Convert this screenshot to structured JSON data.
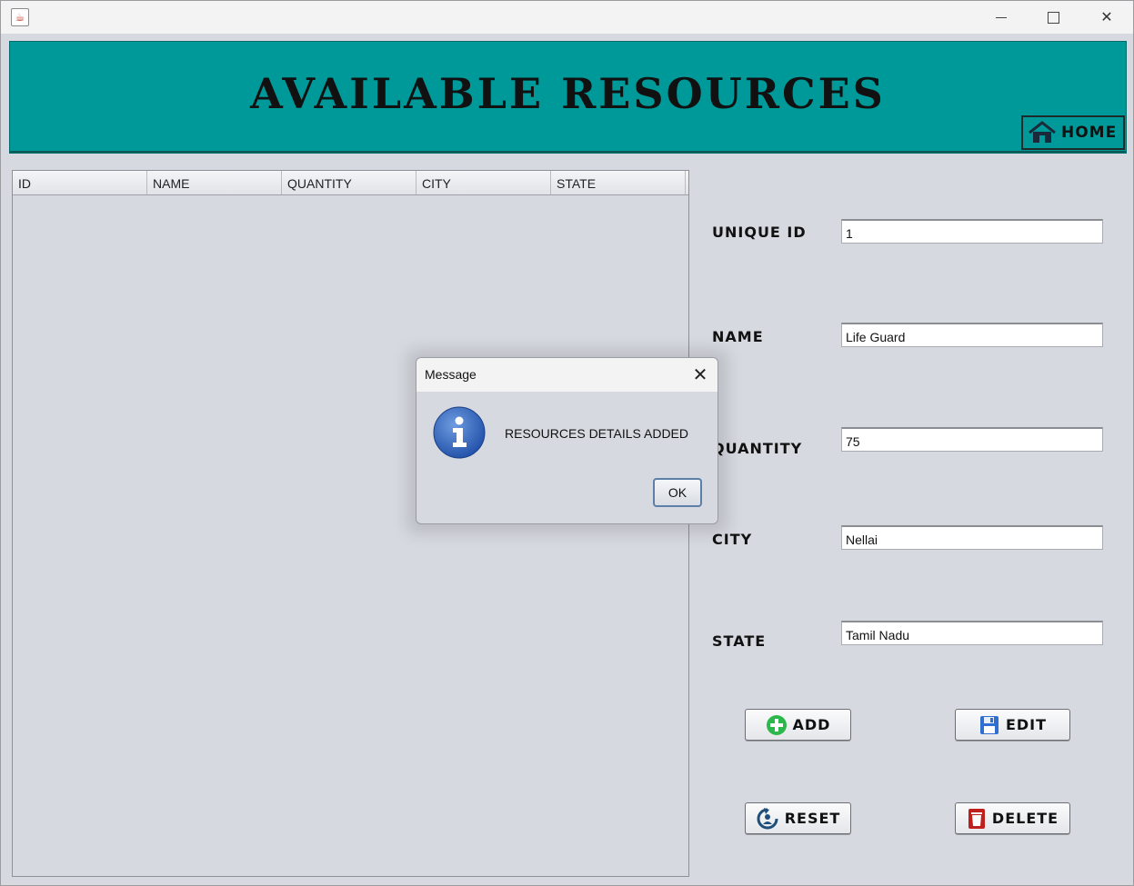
{
  "window": {
    "minimize_icon": "minimize-icon",
    "maximize_icon": "maximize-icon",
    "close_icon": "close-icon"
  },
  "header": {
    "title": "AVAILABLE RESOURCES",
    "home_label": "HOME",
    "background": "#009999"
  },
  "table": {
    "columns": [
      "ID",
      "NAME",
      "QUANTITY",
      "CITY",
      "STATE"
    ],
    "rows": []
  },
  "form": {
    "unique_id": {
      "label": "UNIQUE ID",
      "value": "1"
    },
    "name": {
      "label": "NAME",
      "value": "Life Guard"
    },
    "quantity": {
      "label": "QUANTITY",
      "value": "75"
    },
    "city": {
      "label": "CITY",
      "value": "Nellai"
    },
    "state": {
      "label": "STATE",
      "value": "Tamil Nadu"
    }
  },
  "buttons": {
    "add": "ADD",
    "edit": "EDIT",
    "reset": "RESET",
    "delete": "DELETE"
  },
  "dialog": {
    "title": "Message",
    "message": "RESOURCES DETAILS ADDED",
    "ok": "OK",
    "icon": "info-icon"
  }
}
